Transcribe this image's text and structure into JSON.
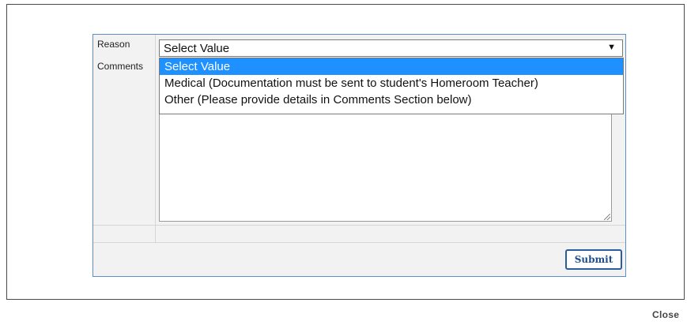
{
  "form": {
    "reason_label": "Reason",
    "comments_label": "Comments",
    "reason_select": {
      "current_value": "Select Value",
      "options": [
        "Select Value",
        "Medical (Documentation must be sent to student's Homeroom Teacher)",
        "Other (Please provide details in Comments Section below)"
      ],
      "highlighted_option": "Select Value"
    },
    "comments_value": "",
    "submit_label": "Submit"
  },
  "footer": {
    "close_label": "Close"
  },
  "colors": {
    "highlight": "#1e90ff",
    "form_border": "#5b8fc7",
    "button_text": "#1f4e8c"
  }
}
